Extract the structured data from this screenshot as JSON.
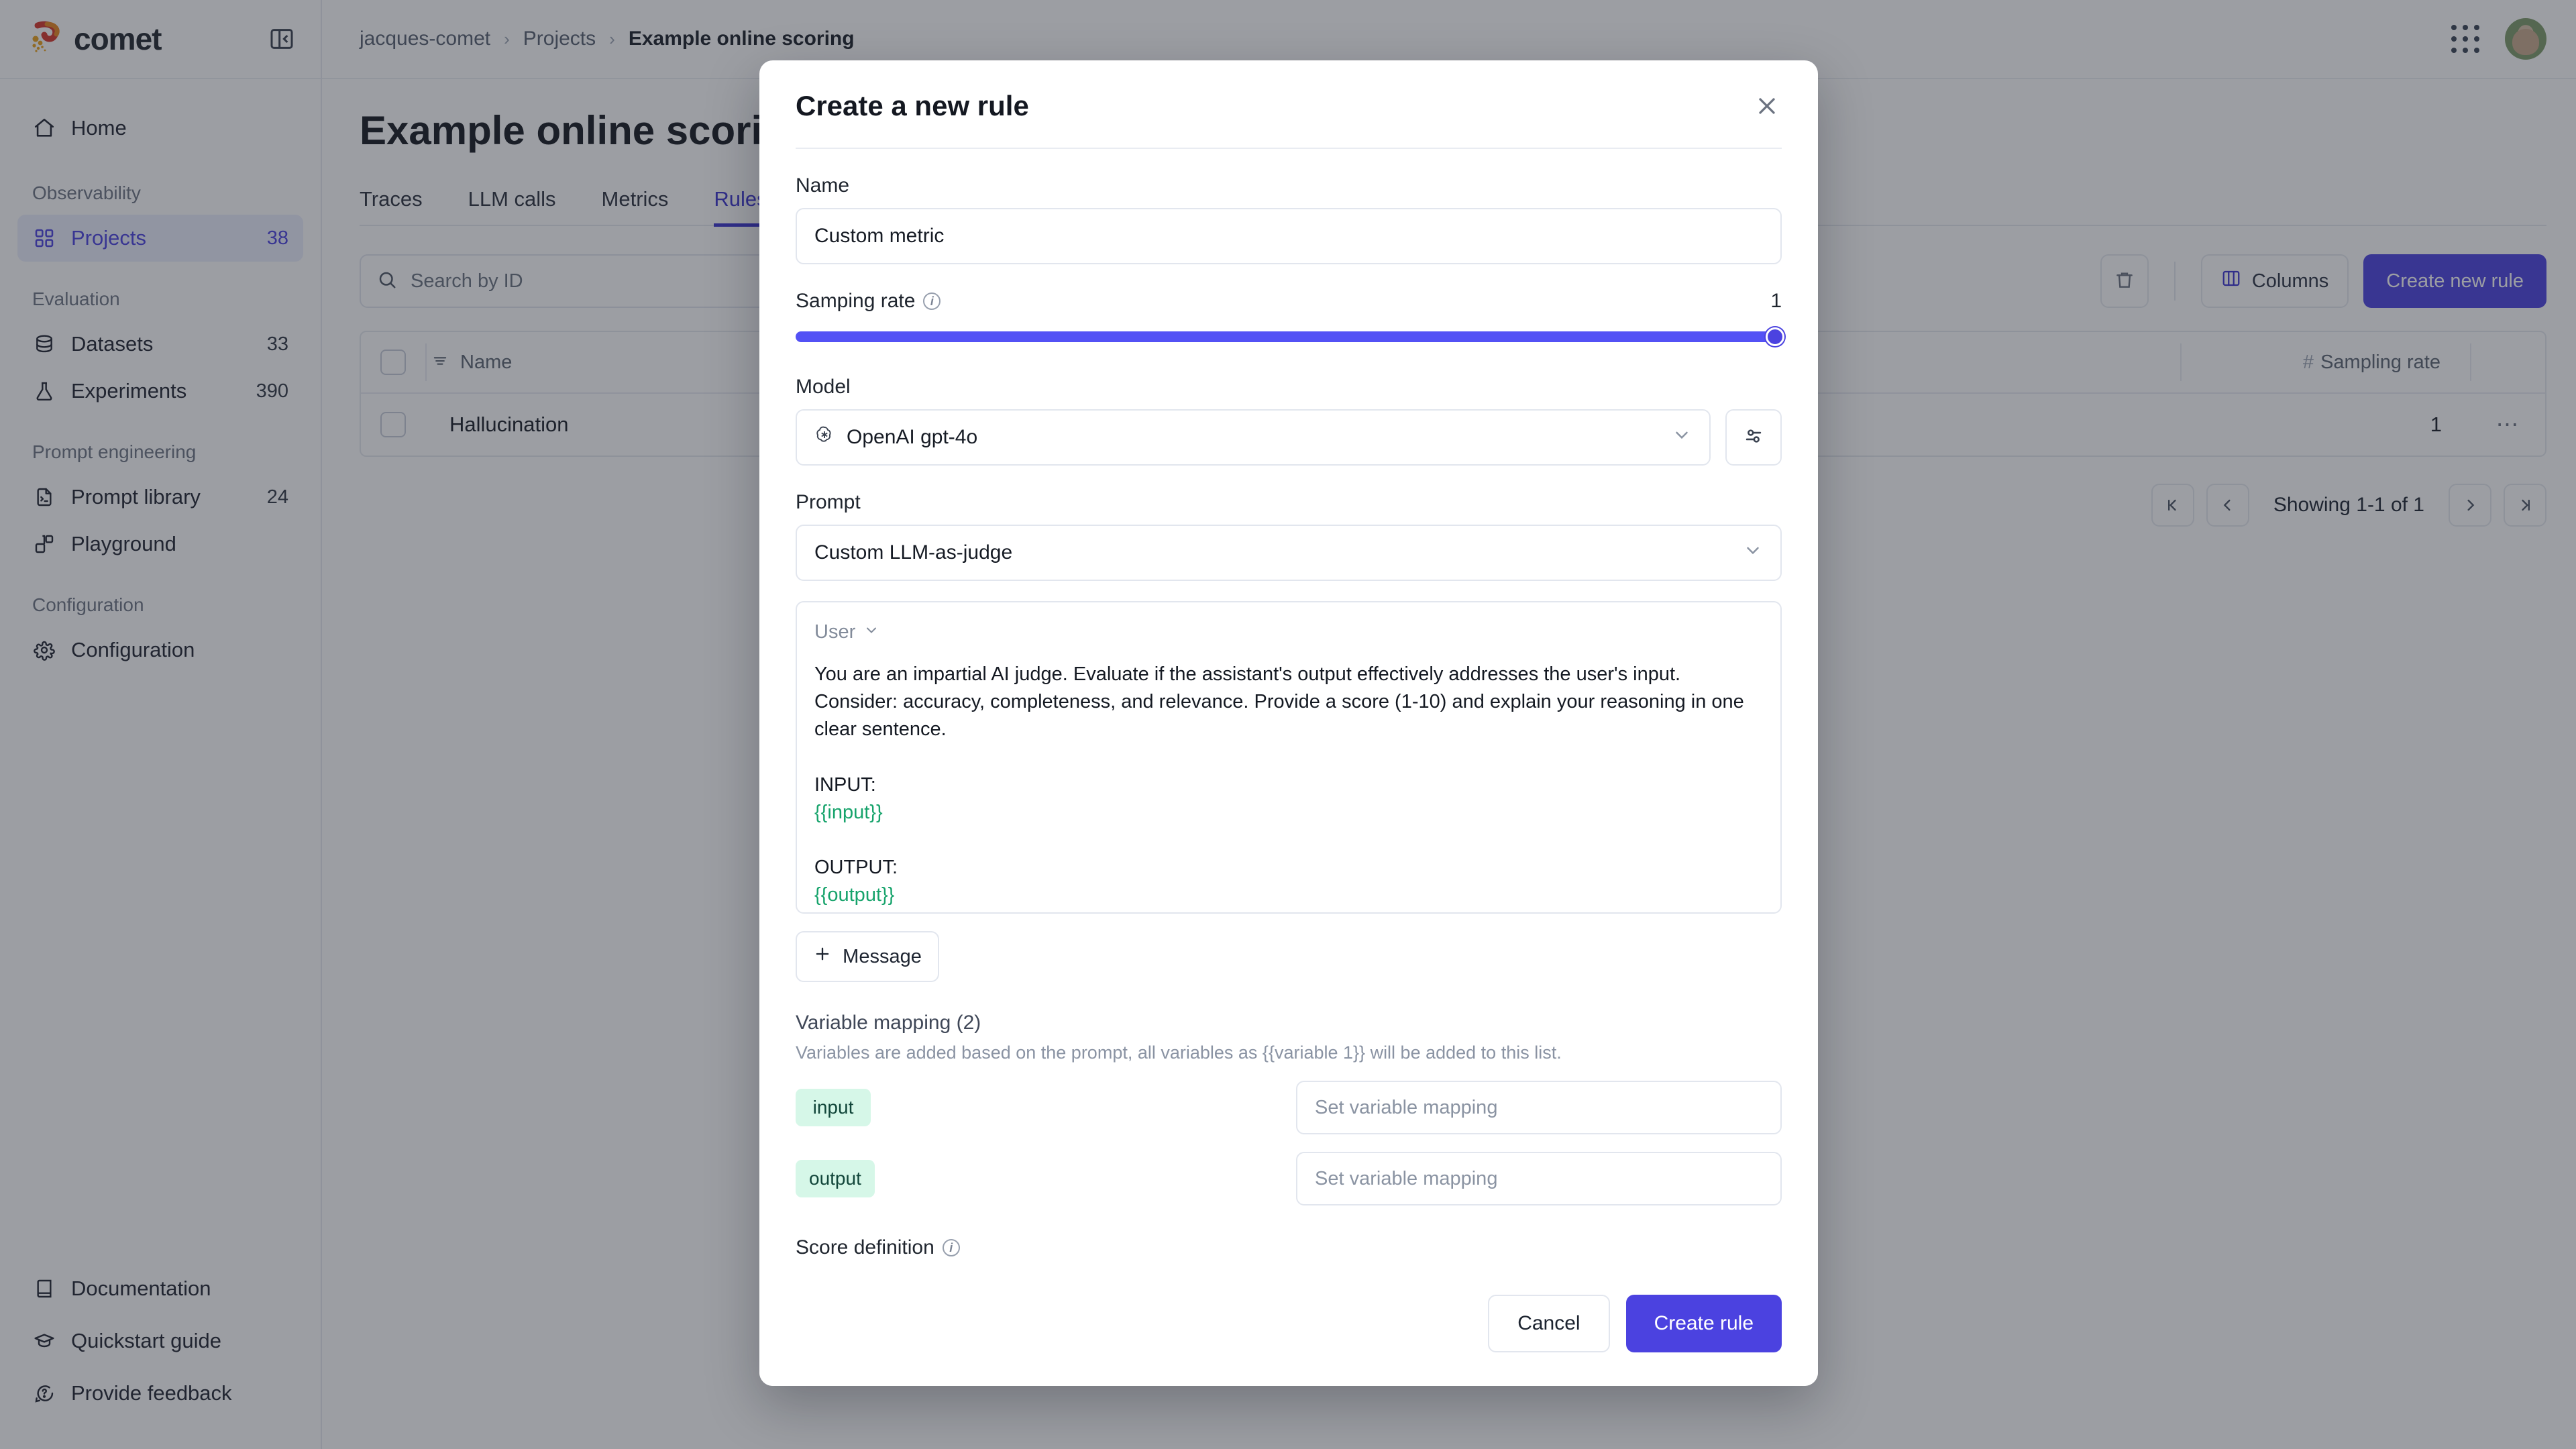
{
  "brand": {
    "name": "comet",
    "accent": "#4b42e0"
  },
  "sidebar": {
    "collapse_icon": "panel-collapse-icon",
    "home": {
      "label": "Home",
      "icon": "home-icon"
    },
    "groups": [
      {
        "label": "Observability",
        "items": [
          {
            "label": "Projects",
            "count": "38",
            "icon": "grid-icon",
            "active": true
          }
        ]
      },
      {
        "label": "Evaluation",
        "items": [
          {
            "label": "Datasets",
            "count": "33",
            "icon": "database-icon",
            "active": false
          },
          {
            "label": "Experiments",
            "count": "390",
            "icon": "flask-icon",
            "active": false
          }
        ]
      },
      {
        "label": "Prompt engineering",
        "items": [
          {
            "label": "Prompt library",
            "count": "24",
            "icon": "file-code-icon",
            "active": false
          },
          {
            "label": "Playground",
            "count": "",
            "icon": "blocks-icon",
            "active": false
          }
        ]
      },
      {
        "label": "Configuration",
        "items": [
          {
            "label": "Configuration",
            "count": "",
            "icon": "settings-icon",
            "active": false
          }
        ]
      }
    ],
    "footer": [
      {
        "label": "Documentation",
        "icon": "book-icon"
      },
      {
        "label": "Quickstart guide",
        "icon": "graduation-cap-icon"
      },
      {
        "label": "Provide feedback",
        "icon": "message-question-icon"
      }
    ]
  },
  "topbar": {
    "breadcrumb": [
      "jacques-comet",
      "Projects",
      "Example online scoring"
    ],
    "apps_icon": "apps-grid-icon",
    "avatar": "user-avatar"
  },
  "page": {
    "title": "Example online scoring",
    "tabs": [
      {
        "label": "Traces",
        "active": false
      },
      {
        "label": "LLM calls",
        "active": false
      },
      {
        "label": "Metrics",
        "active": false
      },
      {
        "label": "Rules",
        "active": true
      }
    ],
    "search": {
      "placeholder": "Search by ID",
      "value": "",
      "icon": "search-icon"
    },
    "delete_icon": "trash-icon",
    "columns_button": {
      "label": "Columns",
      "icon": "columns-icon"
    },
    "create_button": {
      "label": "Create new rule"
    },
    "table": {
      "headers": [
        "Name",
        "Sampling rate"
      ],
      "name_sort_icon": "sort-icon",
      "rate_hash": "#",
      "rows": [
        {
          "name": "Hallucination",
          "sampling_rate": "1",
          "more_icon": "ellipsis-icon"
        }
      ]
    },
    "pagination": {
      "first_icon": "chevrons-left-icon",
      "prev_icon": "chevron-left-icon",
      "text": "Showing 1-1 of 1",
      "next_icon": "chevron-right-icon",
      "last_icon": "chevrons-right-icon"
    }
  },
  "modal": {
    "title": "Create a new rule",
    "close_icon": "close-icon",
    "name": {
      "label": "Name",
      "value": "Custom metric",
      "placeholder": ""
    },
    "sampling_rate": {
      "label": "Samping rate",
      "info_icon": "info-icon",
      "value": "1",
      "percent": 100
    },
    "model": {
      "label": "Model",
      "value": "OpenAI gpt-4o",
      "provider_icon": "openai-icon",
      "chevron_icon": "chevron-down-icon",
      "settings_icon": "sliders-icon"
    },
    "prompt": {
      "label": "Prompt",
      "value": "Custom LLM-as-judge",
      "chevron_icon": "chevron-down-icon"
    },
    "message": {
      "role": "User",
      "role_chevron_icon": "chevron-down-icon",
      "body_part1": "You are an impartial AI judge. Evaluate if the assistant's output effectively addresses the user's input. Consider: accuracy, completeness, and relevance. Provide a score (1-10) and explain your reasoning in one clear sentence.\n\nINPUT:\n",
      "var1": "{{input}}",
      "body_part2": "\n\nOUTPUT:\n",
      "var2": "{{output}}",
      "add_button": {
        "label": "Message",
        "icon": "plus-icon"
      }
    },
    "variable_mapping": {
      "title": "Variable mapping (2)",
      "subtitle": "Variables are added based on the prompt, all variables as {{variable 1}} will be added to this list.",
      "rows": [
        {
          "tag": "input",
          "placeholder": "Set variable mapping",
          "value": ""
        },
        {
          "tag": "output",
          "placeholder": "Set variable mapping",
          "value": ""
        }
      ],
      "tag_bg": "#d6f7e8",
      "tag_color": "#12463a"
    },
    "score_definition": {
      "label": "Score definition",
      "info_icon": "info-icon"
    },
    "footer": {
      "cancel_label": "Cancel",
      "create_label": "Create rule"
    }
  }
}
